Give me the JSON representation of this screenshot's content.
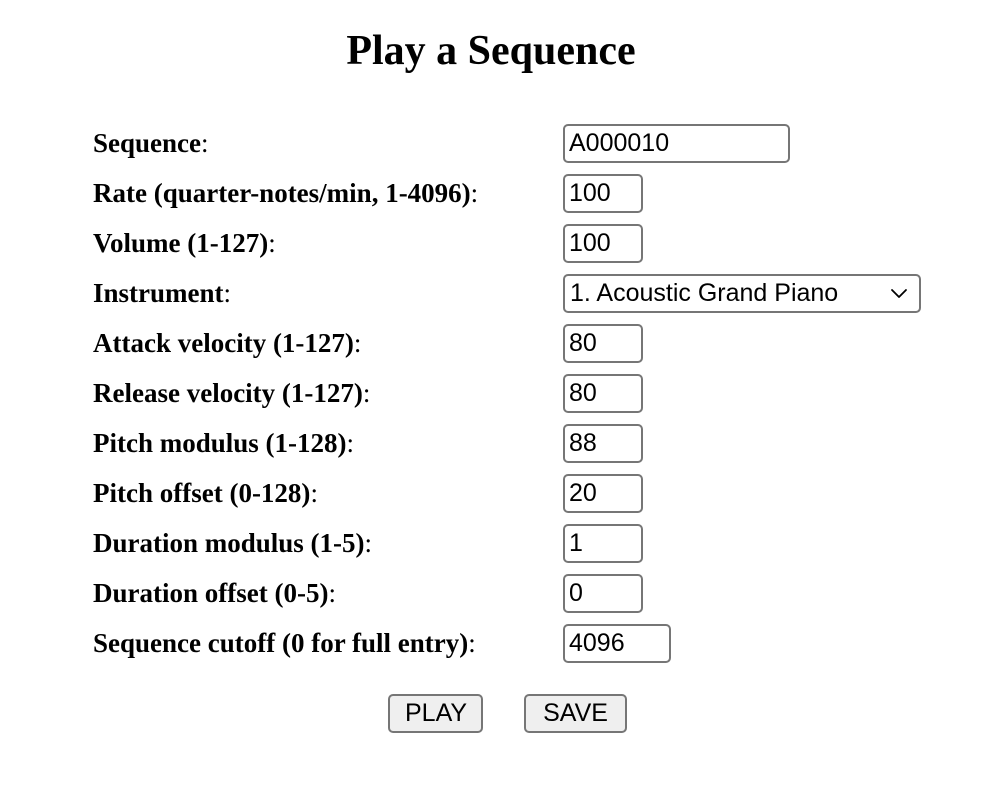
{
  "page": {
    "title": "Play a Sequence"
  },
  "form": {
    "fields": [
      {
        "label": "Sequence",
        "colon": ":",
        "value": "A000010",
        "type": "text",
        "name": "sequence"
      },
      {
        "label": "Rate (quarter-notes/min, 1-4096)",
        "colon": ":",
        "value": "100",
        "type": "number",
        "name": "rate"
      },
      {
        "label": "Volume (1-127)",
        "colon": ":",
        "value": "100",
        "type": "number",
        "name": "volume"
      },
      {
        "label": "Instrument",
        "colon": ":",
        "value": "1. Acoustic Grand Piano",
        "type": "select",
        "name": "instrument"
      },
      {
        "label": "Attack velocity (1-127)",
        "colon": ":",
        "value": "80",
        "type": "number",
        "name": "attack-velocity"
      },
      {
        "label": "Release velocity (1-127)",
        "colon": ":",
        "value": "80",
        "type": "number",
        "name": "release-velocity"
      },
      {
        "label": "Pitch modulus (1-128)",
        "colon": ":",
        "value": "88",
        "type": "number",
        "name": "pitch-modulus"
      },
      {
        "label": "Pitch offset (0-128)",
        "colon": ":",
        "value": "20",
        "type": "number",
        "name": "pitch-offset"
      },
      {
        "label": "Duration modulus (1-5)",
        "colon": ":",
        "value": "1",
        "type": "number",
        "name": "duration-modulus"
      },
      {
        "label": "Duration offset (0-5)",
        "colon": ":",
        "value": "0",
        "type": "number",
        "name": "duration-offset"
      },
      {
        "label": "Sequence cutoff (0 for full entry)",
        "colon": ":",
        "value": "4096",
        "type": "number",
        "name": "sequence-cutoff"
      }
    ],
    "instrument_options": [
      "1. Acoustic Grand Piano"
    ],
    "dropdown_icon": "chevron-down-icon"
  },
  "actions": {
    "play_label": "PLAY",
    "save_label": "SAVE"
  },
  "colors": {
    "background": "#ffffff",
    "text": "#000000",
    "control_border": "#767676",
    "button_face": "#efefef"
  }
}
